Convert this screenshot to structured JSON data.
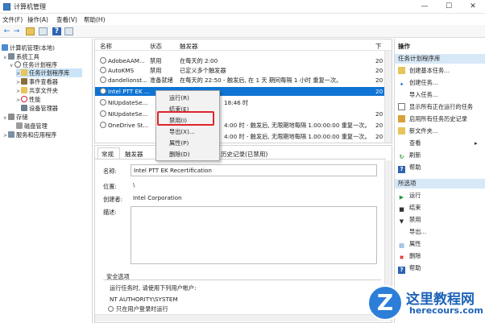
{
  "window": {
    "title": "计算机管理",
    "min": "—",
    "max": "☐",
    "close": "✕"
  },
  "menu": [
    "文件(F)",
    "操作(A)",
    "查看(V)",
    "帮助(H)"
  ],
  "tree": [
    {
      "label": "计算机管理(本地)",
      "exp": ""
    },
    {
      "label": "系统工具",
      "exp": "∨"
    },
    {
      "label": "任务计划程序",
      "exp": "∨"
    },
    {
      "label": "任务计划程序库",
      "exp": ">"
    },
    {
      "label": "事件查看器",
      "exp": ">"
    },
    {
      "label": "共享文件夹",
      "exp": ">"
    },
    {
      "label": "性能",
      "exp": ">"
    },
    {
      "label": "设备管理器",
      "exp": ""
    },
    {
      "label": "存储",
      "exp": "∨"
    },
    {
      "label": "磁盘管理",
      "exp": ""
    },
    {
      "label": "服务和应用程序",
      "exp": ">"
    }
  ],
  "list": {
    "headers": [
      "名称",
      "状态",
      "触发器",
      "下"
    ],
    "rows": [
      {
        "name": "AdobeAAM...",
        "status": "禁用",
        "trigger": "在每天的 2:00",
        "next": "20"
      },
      {
        "name": "AutoKMS",
        "status": "禁用",
        "trigger": "已定义多个触发器",
        "next": "20"
      },
      {
        "name": "dandelionst...",
        "status": "准备就绪",
        "trigger": "在每天的 22:50 - 触发后, 在 1 天 期间每隔 1 小时 重复一次。",
        "next": "20"
      },
      {
        "name": "Intel PTT EK ...",
        "status": "",
        "trigger": "",
        "next": "20"
      },
      {
        "name": "NIUpdateSe...",
        "status": "",
        "trigger": "18:46 时",
        "next": ""
      },
      {
        "name": "NIUpdateSe...",
        "status": "",
        "trigger": "",
        "next": "20"
      },
      {
        "name": "OneDrive St...",
        "status": "",
        "trigger": "4:00 时 - 触发后, 无限期地每隔 1.00:00:00 重复一次。",
        "next": "20"
      },
      {
        "name": "",
        "status": "",
        "trigger": "4:00 时 - 触发后, 无限期地每隔 1.00:00:00 重复一次。",
        "next": "20"
      }
    ]
  },
  "context_menu": [
    "运行(R)",
    "结束(E)",
    "禁用(I)",
    "导出(X)...",
    "属性(P)",
    "删除(D)"
  ],
  "details": {
    "tabs": [
      "常规",
      "触发器",
      "历史记录(已禁用)"
    ],
    "name_label": "名称:",
    "name_value": "Intel PTT EK Recertification",
    "location_label": "位置:",
    "location_value": "\\",
    "author_label": "创建者:",
    "author_value": "Intel Corporation",
    "desc_label": "描述:",
    "security_title": "安全选项",
    "run_as_label": "运行任务时, 请使用下列用户帐户:",
    "run_as_value": "NT AUTHORITY\\SYSTEM",
    "logon_option": "只在用户登录时运行"
  },
  "actions": {
    "header": "操作",
    "section1": "任务计划程序库",
    "items1": [
      "创建基本任务...",
      "创建任务...",
      "导入任务...",
      "显示所有正在运行的任务",
      "启用所有任务历史记录",
      "新文件夹...",
      "查看",
      "刷新",
      "帮助"
    ],
    "section2": "所选项",
    "items2": [
      "运行",
      "结束",
      "禁用",
      "导出...",
      "属性",
      "删除",
      "帮助"
    ]
  },
  "watermark": {
    "logo_letter": "Z",
    "text": "这里教程网",
    "url": "herecours.com"
  },
  "colors": {
    "selection": "#0f74d3",
    "highlight_box": "#e0242a",
    "tree_selected": "#cce4f7",
    "action_section": "#d7e8f7"
  }
}
